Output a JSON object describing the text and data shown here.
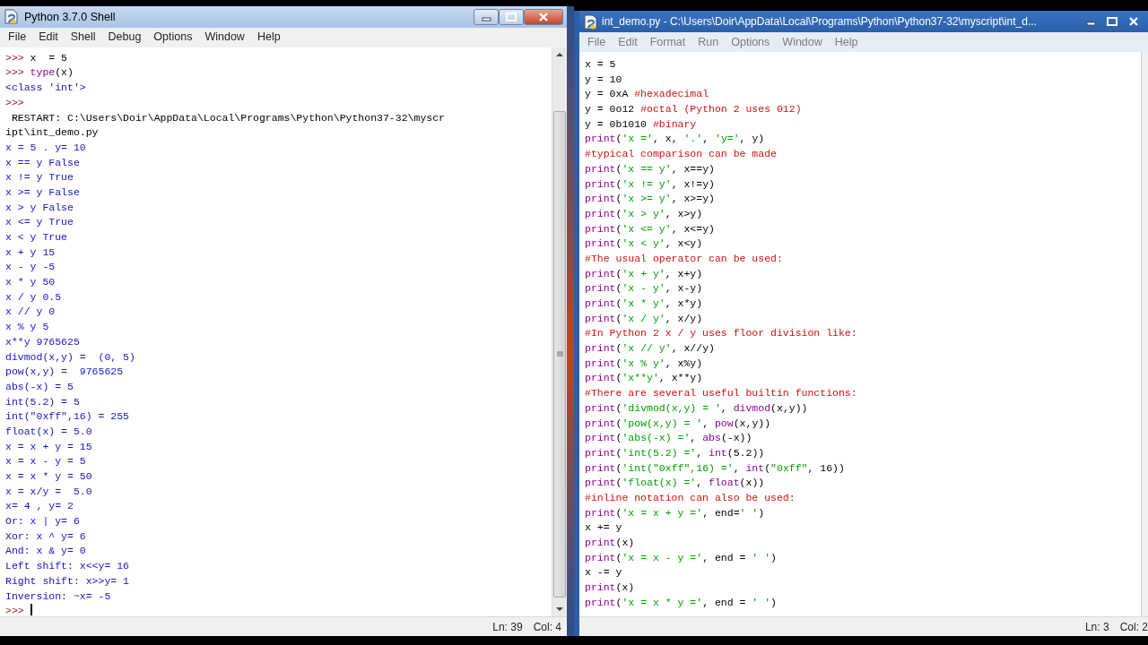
{
  "shell": {
    "title": "Python 3.7.0 Shell",
    "menu": [
      "File",
      "Edit",
      "Shell",
      "Debug",
      "Options",
      "Window",
      "Help"
    ],
    "lines": [
      [
        {
          "kind": "prompt",
          "text": ">>> "
        },
        {
          "kind": "plain",
          "text": "x  = 5"
        }
      ],
      [
        {
          "kind": "prompt",
          "text": ">>> "
        },
        {
          "kind": "builtin",
          "text": "type"
        },
        {
          "kind": "plain",
          "text": "(x)"
        }
      ],
      [
        {
          "kind": "output",
          "text": "<class 'int'>"
        }
      ],
      [
        {
          "kind": "prompt",
          "text": ">>> "
        }
      ],
      [
        {
          "kind": "plain",
          "text": " RESTART: C:\\Users\\Doir\\AppData\\Local\\Programs\\Python\\Python37-32\\myscr"
        }
      ],
      [
        {
          "kind": "plain",
          "text": "ipt\\int_demo.py"
        }
      ],
      [
        {
          "kind": "output",
          "text": "x = 5 . y= 10"
        }
      ],
      [
        {
          "kind": "output",
          "text": "x == y False"
        }
      ],
      [
        {
          "kind": "output",
          "text": "x != y True"
        }
      ],
      [
        {
          "kind": "output",
          "text": "x >= y False"
        }
      ],
      [
        {
          "kind": "output",
          "text": "x > y False"
        }
      ],
      [
        {
          "kind": "output",
          "text": "x <= y True"
        }
      ],
      [
        {
          "kind": "output",
          "text": "x < y True"
        }
      ],
      [
        {
          "kind": "output",
          "text": "x + y 15"
        }
      ],
      [
        {
          "kind": "output",
          "text": "x - y -5"
        }
      ],
      [
        {
          "kind": "output",
          "text": "x * y 50"
        }
      ],
      [
        {
          "kind": "output",
          "text": "x / y 0.5"
        }
      ],
      [
        {
          "kind": "output",
          "text": "x // y 0"
        }
      ],
      [
        {
          "kind": "output",
          "text": "x % y 5"
        }
      ],
      [
        {
          "kind": "output",
          "text": "x**y 9765625"
        }
      ],
      [
        {
          "kind": "output",
          "text": "divmod(x,y) =  (0, 5)"
        }
      ],
      [
        {
          "kind": "output",
          "text": "pow(x,y) =  9765625"
        }
      ],
      [
        {
          "kind": "output",
          "text": "abs(-x) = 5"
        }
      ],
      [
        {
          "kind": "output",
          "text": "int(5.2) = 5"
        }
      ],
      [
        {
          "kind": "output",
          "text": "int(\"0xff\",16) = 255"
        }
      ],
      [
        {
          "kind": "output",
          "text": "float(x) = 5.0"
        }
      ],
      [
        {
          "kind": "output",
          "text": "x = x + y = 15"
        }
      ],
      [
        {
          "kind": "output",
          "text": "x = x - y = 5"
        }
      ],
      [
        {
          "kind": "output",
          "text": "x = x * y = 50"
        }
      ],
      [
        {
          "kind": "output",
          "text": "x = x/y =  5.0"
        }
      ],
      [
        {
          "kind": "output",
          "text": "x= 4 , y= 2"
        }
      ],
      [
        {
          "kind": "output",
          "text": "Or: x | y= 6"
        }
      ],
      [
        {
          "kind": "output",
          "text": "Xor: x ^ y= 6"
        }
      ],
      [
        {
          "kind": "output",
          "text": "And: x & y= 0"
        }
      ],
      [
        {
          "kind": "output",
          "text": "Left shift: x<<y= 16"
        }
      ],
      [
        {
          "kind": "output",
          "text": "Right shift: x>>y= 1"
        }
      ],
      [
        {
          "kind": "output",
          "text": "Inversion: ~x= -5"
        }
      ],
      [
        {
          "kind": "prompt",
          "text": ">>> "
        },
        {
          "kind": "cursor"
        }
      ]
    ],
    "status": {
      "line": "Ln: 39",
      "col": "Col: 4"
    }
  },
  "editor": {
    "title": "int_demo.py - C:\\Users\\Doir\\AppData\\Local\\Programs\\Python\\Python37-32\\myscript\\int_d...",
    "menu": [
      "File",
      "Edit",
      "Format",
      "Run",
      "Options",
      "Window",
      "Help"
    ],
    "lines": [
      [
        {
          "kind": "plain",
          "text": "x = 5"
        }
      ],
      [
        {
          "kind": "plain",
          "text": "y = 10"
        }
      ],
      [
        {
          "kind": "plain",
          "text": "y = 0xA "
        },
        {
          "kind": "comment",
          "text": "#hexadecimal"
        }
      ],
      [
        {
          "kind": "plain",
          "text": "y = 0o12 "
        },
        {
          "kind": "comment",
          "text": "#octal (Python 2 uses 012)"
        }
      ],
      [
        {
          "kind": "plain",
          "text": "y = 0b1010 "
        },
        {
          "kind": "comment",
          "text": "#binary"
        }
      ],
      [
        {
          "kind": "builtin",
          "text": "print"
        },
        {
          "kind": "plain",
          "text": "("
        },
        {
          "kind": "string",
          "text": "'x ='"
        },
        {
          "kind": "plain",
          "text": ", x, "
        },
        {
          "kind": "string",
          "text": "'.'"
        },
        {
          "kind": "plain",
          "text": ", "
        },
        {
          "kind": "string",
          "text": "'y='"
        },
        {
          "kind": "plain",
          "text": ", y)"
        }
      ],
      [
        {
          "kind": "comment",
          "text": "#typical comparison can be made"
        }
      ],
      [
        {
          "kind": "builtin",
          "text": "print"
        },
        {
          "kind": "plain",
          "text": "("
        },
        {
          "kind": "string",
          "text": "'x == y'"
        },
        {
          "kind": "plain",
          "text": ", x==y)"
        }
      ],
      [
        {
          "kind": "builtin",
          "text": "print"
        },
        {
          "kind": "plain",
          "text": "("
        },
        {
          "kind": "string",
          "text": "'x != y'"
        },
        {
          "kind": "plain",
          "text": ", x!=y)"
        }
      ],
      [
        {
          "kind": "builtin",
          "text": "print"
        },
        {
          "kind": "plain",
          "text": "("
        },
        {
          "kind": "string",
          "text": "'x >= y'"
        },
        {
          "kind": "plain",
          "text": ", x>=y)"
        }
      ],
      [
        {
          "kind": "builtin",
          "text": "print"
        },
        {
          "kind": "plain",
          "text": "("
        },
        {
          "kind": "string",
          "text": "'x > y'"
        },
        {
          "kind": "plain",
          "text": ", x>y)"
        }
      ],
      [
        {
          "kind": "builtin",
          "text": "print"
        },
        {
          "kind": "plain",
          "text": "("
        },
        {
          "kind": "string",
          "text": "'x <= y'"
        },
        {
          "kind": "plain",
          "text": ", x<=y)"
        }
      ],
      [
        {
          "kind": "builtin",
          "text": "print"
        },
        {
          "kind": "plain",
          "text": "("
        },
        {
          "kind": "string",
          "text": "'x < y'"
        },
        {
          "kind": "plain",
          "text": ", x<y)"
        }
      ],
      [
        {
          "kind": "comment",
          "text": "#The usual operator can be used:"
        }
      ],
      [
        {
          "kind": "builtin",
          "text": "print"
        },
        {
          "kind": "plain",
          "text": "("
        },
        {
          "kind": "string",
          "text": "'x + y'"
        },
        {
          "kind": "plain",
          "text": ", x+y)"
        }
      ],
      [
        {
          "kind": "builtin",
          "text": "print"
        },
        {
          "kind": "plain",
          "text": "("
        },
        {
          "kind": "string",
          "text": "'x - y'"
        },
        {
          "kind": "plain",
          "text": ", x-y)"
        }
      ],
      [
        {
          "kind": "builtin",
          "text": "print"
        },
        {
          "kind": "plain",
          "text": "("
        },
        {
          "kind": "string",
          "text": "'x * y'"
        },
        {
          "kind": "plain",
          "text": ", x*y)"
        }
      ],
      [
        {
          "kind": "builtin",
          "text": "print"
        },
        {
          "kind": "plain",
          "text": "("
        },
        {
          "kind": "string",
          "text": "'x / y'"
        },
        {
          "kind": "plain",
          "text": ", x/y)"
        }
      ],
      [
        {
          "kind": "comment",
          "text": "#In Python 2 x / y uses floor division like:"
        }
      ],
      [
        {
          "kind": "builtin",
          "text": "print"
        },
        {
          "kind": "plain",
          "text": "("
        },
        {
          "kind": "string",
          "text": "'x // y'"
        },
        {
          "kind": "plain",
          "text": ", x//y)"
        }
      ],
      [
        {
          "kind": "builtin",
          "text": "print"
        },
        {
          "kind": "plain",
          "text": "("
        },
        {
          "kind": "string",
          "text": "'x % y'"
        },
        {
          "kind": "plain",
          "text": ", x%y)"
        }
      ],
      [
        {
          "kind": "builtin",
          "text": "print"
        },
        {
          "kind": "plain",
          "text": "("
        },
        {
          "kind": "string",
          "text": "'x**y'"
        },
        {
          "kind": "plain",
          "text": ", x**y)"
        }
      ],
      [
        {
          "kind": "comment",
          "text": "#There are several useful builtin functions:"
        }
      ],
      [
        {
          "kind": "builtin",
          "text": "print"
        },
        {
          "kind": "plain",
          "text": "("
        },
        {
          "kind": "string",
          "text": "'divmod(x,y) = '"
        },
        {
          "kind": "plain",
          "text": ", "
        },
        {
          "kind": "builtin",
          "text": "divmod"
        },
        {
          "kind": "plain",
          "text": "(x,y))"
        }
      ],
      [
        {
          "kind": "builtin",
          "text": "print"
        },
        {
          "kind": "plain",
          "text": "("
        },
        {
          "kind": "string",
          "text": "'pow(x,y) = '"
        },
        {
          "kind": "plain",
          "text": ", "
        },
        {
          "kind": "builtin",
          "text": "pow"
        },
        {
          "kind": "plain",
          "text": "(x,y))"
        }
      ],
      [
        {
          "kind": "builtin",
          "text": "print"
        },
        {
          "kind": "plain",
          "text": "("
        },
        {
          "kind": "string",
          "text": "'abs(-x) ='"
        },
        {
          "kind": "plain",
          "text": ", "
        },
        {
          "kind": "builtin",
          "text": "abs"
        },
        {
          "kind": "plain",
          "text": "(-x))"
        }
      ],
      [
        {
          "kind": "builtin",
          "text": "print"
        },
        {
          "kind": "plain",
          "text": "("
        },
        {
          "kind": "string",
          "text": "'int(5.2) ='"
        },
        {
          "kind": "plain",
          "text": ", "
        },
        {
          "kind": "builtin",
          "text": "int"
        },
        {
          "kind": "plain",
          "text": "(5.2))"
        }
      ],
      [
        {
          "kind": "builtin",
          "text": "print"
        },
        {
          "kind": "plain",
          "text": "("
        },
        {
          "kind": "string",
          "text": "'int(\"0xff\",16) ='"
        },
        {
          "kind": "plain",
          "text": ", "
        },
        {
          "kind": "builtin",
          "text": "int"
        },
        {
          "kind": "plain",
          "text": "("
        },
        {
          "kind": "string",
          "text": "\"0xff\""
        },
        {
          "kind": "plain",
          "text": ", 16))"
        }
      ],
      [
        {
          "kind": "builtin",
          "text": "print"
        },
        {
          "kind": "plain",
          "text": "("
        },
        {
          "kind": "string",
          "text": "'float(x) ='"
        },
        {
          "kind": "plain",
          "text": ", "
        },
        {
          "kind": "builtin",
          "text": "float"
        },
        {
          "kind": "plain",
          "text": "(x))"
        }
      ],
      [
        {
          "kind": "comment",
          "text": "#inline notation can also be used:"
        }
      ],
      [
        {
          "kind": "builtin",
          "text": "print"
        },
        {
          "kind": "plain",
          "text": "("
        },
        {
          "kind": "string",
          "text": "'x = x + y ='"
        },
        {
          "kind": "plain",
          "text": ", end="
        },
        {
          "kind": "string",
          "text": "' '"
        },
        {
          "kind": "plain",
          "text": ")"
        }
      ],
      [
        {
          "kind": "plain",
          "text": "x += y"
        }
      ],
      [
        {
          "kind": "builtin",
          "text": "print"
        },
        {
          "kind": "plain",
          "text": "(x)"
        }
      ],
      [
        {
          "kind": "builtin",
          "text": "print"
        },
        {
          "kind": "plain",
          "text": "("
        },
        {
          "kind": "string",
          "text": "'x = x - y ='"
        },
        {
          "kind": "plain",
          "text": ", end = "
        },
        {
          "kind": "string",
          "text": "' '"
        },
        {
          "kind": "plain",
          "text": ")"
        }
      ],
      [
        {
          "kind": "plain",
          "text": "x -= y"
        }
      ],
      [
        {
          "kind": "builtin",
          "text": "print"
        },
        {
          "kind": "plain",
          "text": "(x)"
        }
      ],
      [
        {
          "kind": "builtin",
          "text": "print"
        },
        {
          "kind": "plain",
          "text": "("
        },
        {
          "kind": "string",
          "text": "'x = x * y ='"
        },
        {
          "kind": "plain",
          "text": ", end = "
        },
        {
          "kind": "string",
          "text": "' '"
        },
        {
          "kind": "plain",
          "text": ")"
        }
      ]
    ],
    "status": {
      "line": "Ln: 3",
      "col": "Col: 2"
    }
  }
}
